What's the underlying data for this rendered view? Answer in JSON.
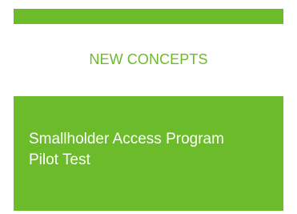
{
  "colors": {
    "accent": "#6cbb2a",
    "card_text": "#ffffff"
  },
  "section": {
    "heading": "NEW CONCEPTS"
  },
  "concept_card": {
    "title_line_1": "Smallholder Access Program",
    "title_line_2": "Pilot Test"
  }
}
